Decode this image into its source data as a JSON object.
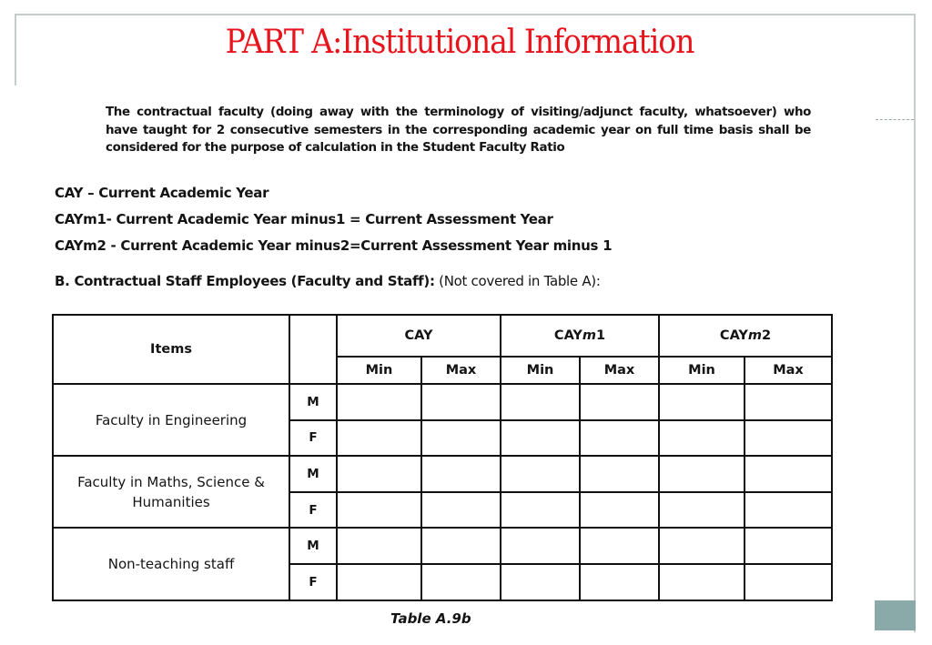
{
  "slide": {
    "title": "PART A:Institutional Information",
    "intro_paragraph": "The contractual faculty (doing away with the terminology of visiting/adjunct faculty, whatsoever) who have taught for 2 consecutive semesters in the corresponding academic year on full time basis shall be considered for the purpose of calculation in the Student Faculty Ratio",
    "definitions": [
      "CAY – Current Academic Year",
      "CAYm1- Current Academic Year minus1 = Current Assessment Year",
      "CAYm2 - Current Academic Year minus2=Current Assessment Year minus 1"
    ],
    "section_heading": {
      "bold": "B. Contractual Staff Employees (Faculty and Staff):",
      "normal": " (Not covered in Table A):"
    },
    "colors": {
      "title": "#e8141c",
      "accent_square": "#8aa9a9",
      "frame": "#c4cccc"
    }
  },
  "table": {
    "items_header": "Items",
    "year_groups": [
      {
        "prefix": "CAY",
        "suffix_italic": "",
        "suffix": ""
      },
      {
        "prefix": "CAY",
        "suffix_italic": "m",
        "suffix": "1"
      },
      {
        "prefix": "CAY",
        "suffix_italic": "m",
        "suffix": "2"
      }
    ],
    "sub_headers": [
      "Min",
      "Max"
    ],
    "rows": [
      {
        "item": "Faculty in Engineering",
        "genders": [
          "M",
          "F"
        ],
        "values": [
          [
            "",
            "",
            "",
            "",
            "",
            ""
          ],
          [
            "",
            "",
            "",
            "",
            "",
            ""
          ]
        ]
      },
      {
        "item": "Faculty in Maths, Science & Humanities",
        "genders": [
          "M",
          "F"
        ],
        "values": [
          [
            "",
            "",
            "",
            "",
            "",
            ""
          ],
          [
            "",
            "",
            "",
            "",
            "",
            ""
          ]
        ]
      },
      {
        "item": "Non-teaching staff",
        "genders": [
          "M",
          "F"
        ],
        "values": [
          [
            "",
            "",
            "",
            "",
            "",
            ""
          ],
          [
            "",
            "",
            "",
            "",
            "",
            ""
          ]
        ]
      }
    ],
    "caption": "Table A.9b"
  }
}
